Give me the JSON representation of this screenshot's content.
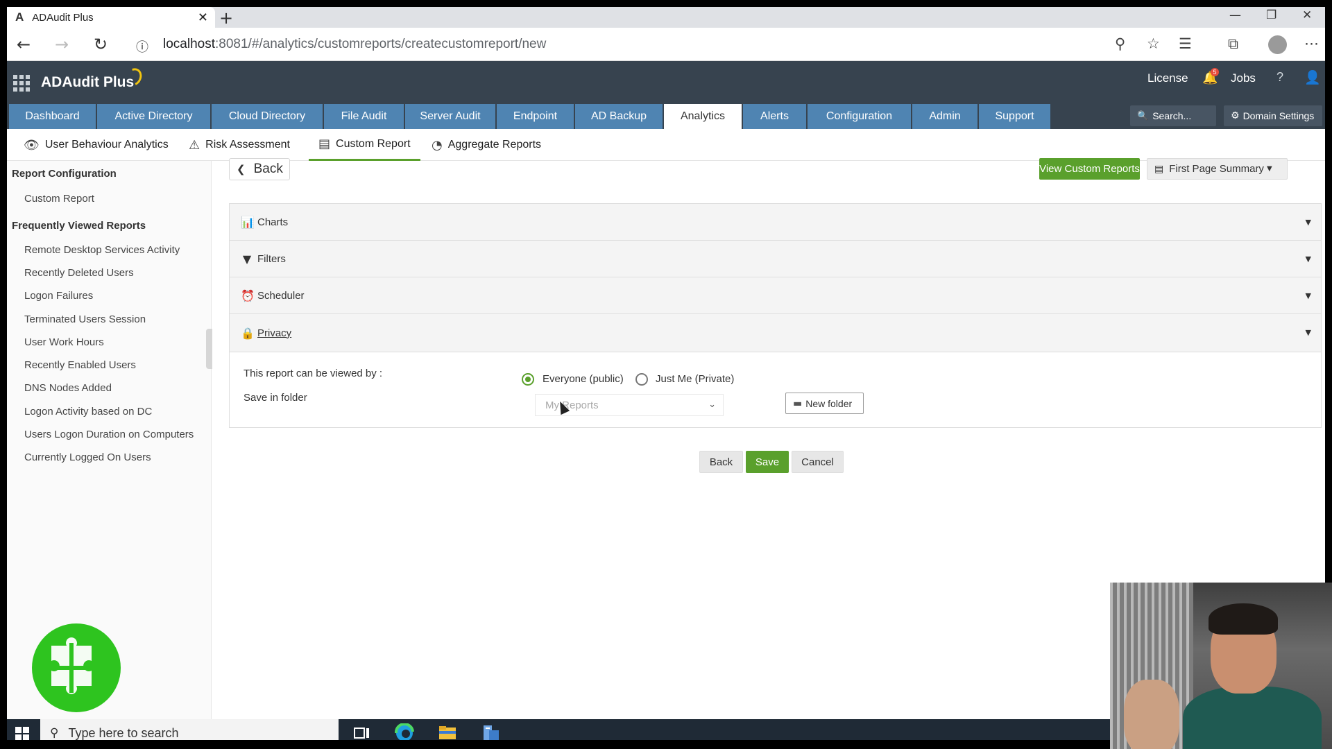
{
  "browser": {
    "tab_title": "ADAudit Plus",
    "url_host": "localhost",
    "url_path": ":8081/#/analytics/customreports/createcustomreport/new"
  },
  "app": {
    "brand": "ADAudit Plus",
    "header_links": {
      "license": "License",
      "jobs": "Jobs",
      "help": "?"
    },
    "notification_count": "5",
    "nav_tabs": [
      "Dashboard",
      "Active Directory",
      "Cloud Directory",
      "File Audit",
      "Server Audit",
      "Endpoint",
      "AD Backup",
      "Analytics",
      "Alerts",
      "Configuration",
      "Admin",
      "Support"
    ],
    "active_tab": "Analytics",
    "search_placeholder": "Search...",
    "domain_settings": "Domain Settings"
  },
  "subnav": {
    "items": [
      "User Behaviour Analytics",
      "Risk Assessment",
      "Custom Report",
      "Aggregate Reports"
    ],
    "active": "Custom Report"
  },
  "sidebar": {
    "section1": "Report Configuration",
    "section1_items": [
      "Custom Report"
    ],
    "section2": "Frequently Viewed Reports",
    "section2_items": [
      "Remote Desktop Services Activity",
      "Recently Deleted Users",
      "Logon Failures",
      "Terminated Users Session",
      "User Work Hours",
      "Recently Enabled Users",
      "DNS Nodes Added",
      "Logon Activity based on DC",
      "Users Logon Duration on Computers",
      "Currently Logged On Users"
    ]
  },
  "main": {
    "back_top": "Back",
    "view_custom_reports": "View Custom Reports",
    "first_page_summary": "First Page Summary",
    "accordion": [
      "Charts",
      "Filters",
      "Scheduler",
      "Privacy"
    ],
    "privacy": {
      "viewed_by_label": "This report can be viewed by :",
      "option_public": "Everyone (public)",
      "option_private": "Just Me (Private)",
      "selected": "Everyone (public)",
      "save_folder_label": "Save in folder",
      "folder_value": "My Reports",
      "new_folder": "New folder"
    },
    "footer_buttons": {
      "back": "Back",
      "save": "Save",
      "cancel": "Cancel"
    }
  },
  "taskbar": {
    "search_placeholder": "Type here to search"
  },
  "colors": {
    "header_bg": "#37434f",
    "nav_tab_bg": "#4f84b2",
    "accent_green": "#5aa02c"
  }
}
